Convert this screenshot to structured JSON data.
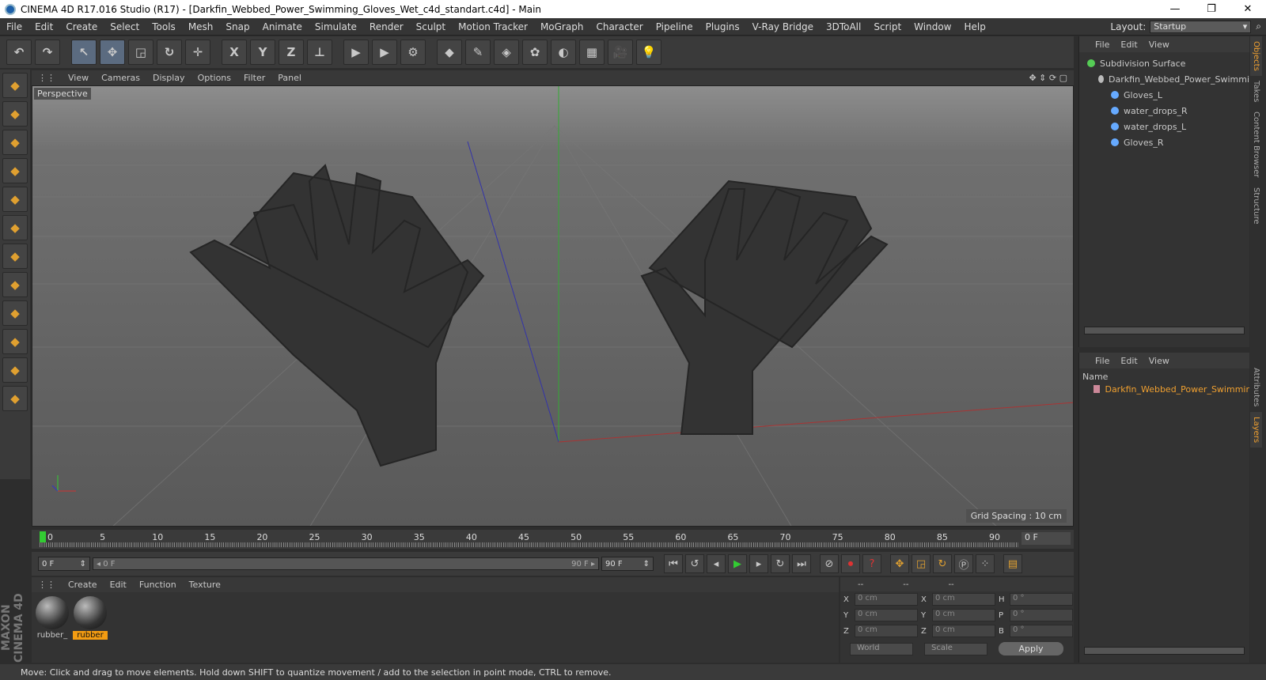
{
  "titlebar": {
    "title": "CINEMA 4D R17.016 Studio (R17) - [Darkfin_Webbed_Power_Swimming_Gloves_Wet_c4d_standart.c4d] - Main",
    "minimize": "—",
    "maximize": "❐",
    "close": "✕"
  },
  "menu": [
    "File",
    "Edit",
    "Create",
    "Select",
    "Tools",
    "Mesh",
    "Snap",
    "Animate",
    "Simulate",
    "Render",
    "Sculpt",
    "Motion Tracker",
    "MoGraph",
    "Character",
    "Pipeline",
    "Plugins",
    "V-Ray Bridge",
    "3DToAll",
    "Script",
    "Window",
    "Help"
  ],
  "layout": {
    "label": "Layout:",
    "value": "Startup"
  },
  "toolbar": [
    {
      "name": "undo-icon",
      "glyph": "↶"
    },
    {
      "name": "redo-icon",
      "glyph": "↷"
    },
    {
      "name": "select-icon",
      "glyph": "↖",
      "sel": true
    },
    {
      "name": "move-icon",
      "glyph": "✥",
      "sel": true
    },
    {
      "name": "scale-icon",
      "glyph": "◲"
    },
    {
      "name": "rotate-icon",
      "glyph": "↻"
    },
    {
      "name": "transform-icon",
      "glyph": "✛"
    },
    {
      "name": "x-axis-icon",
      "glyph": "X"
    },
    {
      "name": "y-axis-icon",
      "glyph": "Y"
    },
    {
      "name": "z-axis-icon",
      "glyph": "Z"
    },
    {
      "name": "coord-system-icon",
      "glyph": "⊥"
    },
    {
      "name": "render-view-icon",
      "glyph": "▶"
    },
    {
      "name": "render-picture-icon",
      "glyph": "▶"
    },
    {
      "name": "render-settings-icon",
      "glyph": "⚙"
    },
    {
      "name": "cube-icon",
      "glyph": "◆"
    },
    {
      "name": "pen-icon",
      "glyph": "✎"
    },
    {
      "name": "subdivision-icon",
      "glyph": "◈"
    },
    {
      "name": "mograph-icon",
      "glyph": "✿"
    },
    {
      "name": "deformer-icon",
      "glyph": "◐"
    },
    {
      "name": "floor-icon",
      "glyph": "▦"
    },
    {
      "name": "camera-icon",
      "glyph": "🎥"
    },
    {
      "name": "light-icon",
      "glyph": "💡"
    }
  ],
  "lefttools": [
    "model-mode-icon",
    "texture-mode-icon",
    "workplane-icon",
    "points-icon",
    "edges-icon",
    "polygons-icon",
    "axis-icon",
    "mouse-icon",
    "snap-s-icon",
    "magnet-icon",
    "grid-lock-icon",
    "grid-paint-icon"
  ],
  "viewport": {
    "menu": [
      "View",
      "Cameras",
      "Display",
      "Options",
      "Filter",
      "Panel"
    ],
    "label": "Perspective",
    "grid_spacing": "Grid Spacing : 10 cm"
  },
  "timeline": {
    "frames": [
      "0",
      "5",
      "10",
      "15",
      "20",
      "25",
      "30",
      "35",
      "40",
      "45",
      "50",
      "55",
      "60",
      "65",
      "70",
      "75",
      "80",
      "85",
      "90"
    ],
    "end": "0 F"
  },
  "transport": {
    "start": "0 F",
    "slider_left": "◂ 0 F",
    "slider_right": "90 F ▸",
    "end": "90 F"
  },
  "materials": {
    "menu": [
      "Create",
      "Edit",
      "Function",
      "Texture"
    ],
    "items": [
      {
        "label": "rubber_",
        "active": false
      },
      {
        "label": "rubber",
        "active": true
      }
    ]
  },
  "maxon": "MAXON CINEMA 4D",
  "coords": {
    "headers": [
      "--",
      "--",
      "--"
    ],
    "rows": [
      {
        "a": "X",
        "v1": "0 cm",
        "b": "X",
        "v2": "0 cm",
        "c": "H",
        "v3": "0 °"
      },
      {
        "a": "Y",
        "v1": "0 cm",
        "b": "Y",
        "v2": "0 cm",
        "c": "P",
        "v3": "0 °"
      },
      {
        "a": "Z",
        "v1": "0 cm",
        "b": "Z",
        "v2": "0 cm",
        "c": "B",
        "v3": "0 °"
      }
    ],
    "world": "World",
    "scale": "Scale",
    "apply": "Apply"
  },
  "status": "Move: Click and drag to move elements. Hold down SHIFT to quantize movement / add to the selection in point mode, CTRL to remove.",
  "objects": {
    "menu": [
      "File",
      "Edit",
      "View"
    ],
    "tree": [
      {
        "label": "Subdivision Surface",
        "indent": 0,
        "color": "#5c5"
      },
      {
        "label": "Darkfin_Webbed_Power_Swimmi",
        "indent": 14,
        "color": "#bbb"
      },
      {
        "label": "Gloves_L",
        "indent": 30,
        "color": "#6af"
      },
      {
        "label": "water_drops_R",
        "indent": 30,
        "color": "#6af"
      },
      {
        "label": "water_drops_L",
        "indent": 30,
        "color": "#6af"
      },
      {
        "label": "Gloves_R",
        "indent": 30,
        "color": "#6af"
      }
    ]
  },
  "layers": {
    "menu": [
      "File",
      "Edit",
      "View"
    ],
    "name_header": "Name",
    "item": "Darkfin_Webbed_Power_Swimmir"
  },
  "sidetabs": [
    "Objects",
    "Takes",
    "Content Browser",
    "Structure",
    "Attributes",
    "Layers"
  ]
}
